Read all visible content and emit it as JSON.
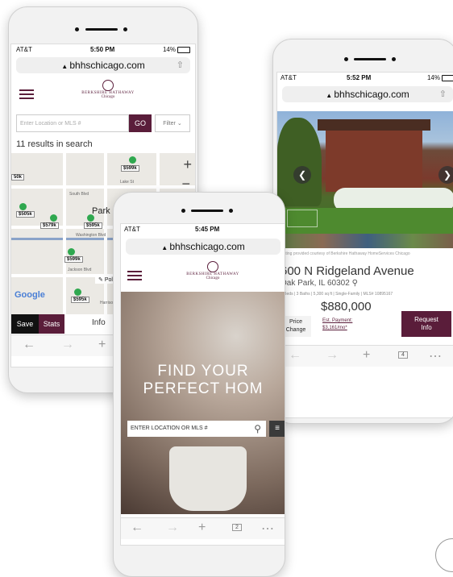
{
  "phone_left": {
    "status": {
      "carrier": "AT&T",
      "time": "5:50 PM",
      "battery": "14%"
    },
    "url": "bhhschicago.com",
    "logo": {
      "name": "BERKSHIRE HATHAWAY",
      "sub": "Chicago"
    },
    "search": {
      "placeholder": "Enter Location or MLS #",
      "go": "GO",
      "filter": "Filter"
    },
    "results": "11 results in search",
    "map": {
      "prices": [
        "$599k",
        "50k",
        "$505k",
        "$579k",
        "$595k",
        "$599k",
        "$595k"
      ],
      "labels": [
        "Lake St",
        "South Blvd",
        "Park",
        "Washington Blvd",
        "Jackson Blvd",
        "Harrison St",
        "Polygon"
      ],
      "google": "Google"
    },
    "tabs": {
      "save": "Save",
      "stats": "Stats",
      "info": "Info"
    }
  },
  "phone_center": {
    "status": {
      "carrier": "AT&T",
      "time": "5:45 PM"
    },
    "url": "bhhschicago.com",
    "logo": {
      "name": "BERKSHIRE HATHAWAY",
      "sub": "Chicago"
    },
    "hero": {
      "line1": "FIND YOUR",
      "line2": "PERFECT HOM"
    },
    "search": {
      "placeholder": "ENTER LOCATION OR MLS #"
    },
    "tab_count": "2"
  },
  "phone_right": {
    "status": {
      "carrier": "AT&T",
      "time": "5:52 PM",
      "battery": "14%"
    },
    "url": "bhhschicago.com",
    "courtesy": "Listing provided courtesy of Berkshire Hathaway HomeServices Chicago",
    "address": "600 N Ridgeland Avenue",
    "city": "Oak Park, IL 60302",
    "specs": "5 Beds | 3 Baths | 5,300 sq ft | Single-Family | MLS# 10895167",
    "price": "$880,000",
    "price_change": [
      "Price",
      "Change"
    ],
    "est_payment": [
      "Est. Payment:",
      "$3,161/mo*"
    ],
    "request": [
      "Request",
      "Info"
    ],
    "tab_count": "4"
  },
  "colors": {
    "brand": "#5a1d3a",
    "pin": "#2fa84f"
  }
}
